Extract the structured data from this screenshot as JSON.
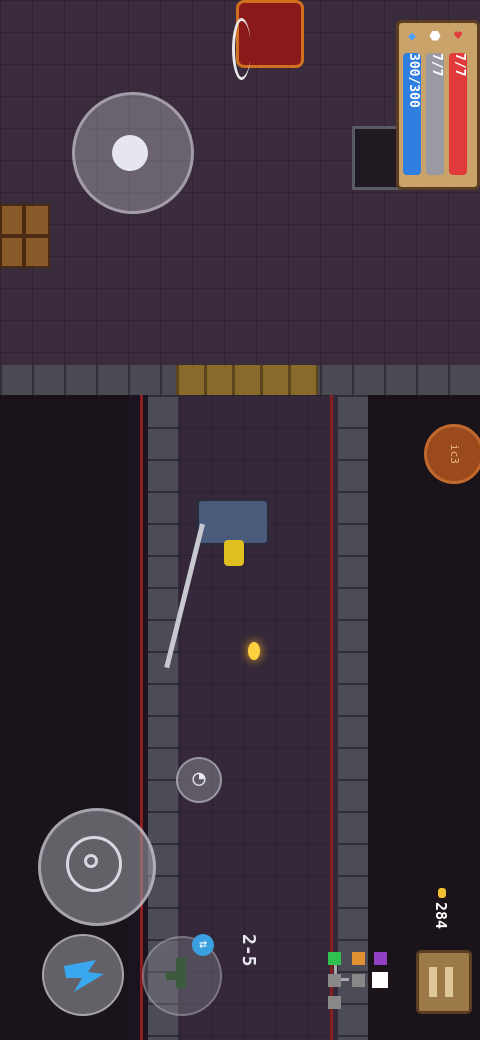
{
  "hud": {
    "hp": "7/7",
    "armor": "7/7",
    "energy": "300/300",
    "hp_icon": "heart-icon",
    "armor_icon": "shield-icon",
    "energy_icon": "diamond-icon"
  },
  "level": "2-5",
  "gold": "284",
  "orange_button_label": "ic3",
  "colors": {
    "hp": "#e03a3a",
    "armor": "#9a9aa4",
    "energy": "#2f7fe0",
    "panel": "#c9a36a"
  },
  "minimap": {
    "rooms": [
      "start",
      "current",
      "shop",
      "boss",
      "unexplored"
    ]
  }
}
